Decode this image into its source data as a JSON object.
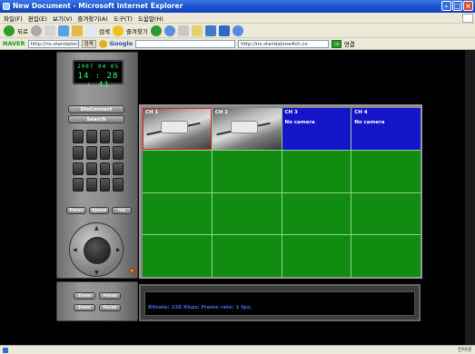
{
  "window": {
    "title": "New Document - Microsoft Internet Explorer"
  },
  "menu": {
    "items": [
      "파일(F)",
      "편집(E)",
      "보기(V)",
      "즐겨찾기(A)",
      "도구(T)",
      "도움말(H)"
    ]
  },
  "toolbar": {
    "back": "뒤로",
    "search": "검색",
    "favorites": "즐겨찾기"
  },
  "links": {
    "naver": "NAVER",
    "address1": "http://ns.standalone4ch.",
    "search_btn": "검색",
    "google": "Google",
    "address2": "http://ns.standalone4ch.co",
    "links_label": "연결"
  },
  "dvr": {
    "date": "2007 04 05",
    "time": "14 : 28 : 41",
    "disconnect_label": "DisConnect",
    "search_label": "Search",
    "row_buttons": [
      "Focus",
      "Speed",
      "Iris"
    ],
    "bottom_buttons": [
      "Zoom",
      "Focus",
      "Zoom",
      "Focus"
    ],
    "keypad": [
      "",
      "",
      "",
      "",
      "",
      "",
      "",
      "",
      "",
      "",
      "",
      "",
      "",
      "",
      "",
      ""
    ]
  },
  "cameras": [
    {
      "ch": "CH 1",
      "status": ""
    },
    {
      "ch": "CH 2",
      "status": ""
    },
    {
      "ch": "CH 3",
      "status": "No camera"
    },
    {
      "ch": "CH 4",
      "status": "No camera"
    }
  ],
  "info": {
    "text": "Bitrate: 236 Kbps; Frame rate: 1 fps;"
  },
  "status": {
    "zone": "인터넷"
  },
  "colors": {
    "grid_green": "#108c10",
    "camera_blue": "#1414c8",
    "panel_gray": "#8a8a8a"
  }
}
